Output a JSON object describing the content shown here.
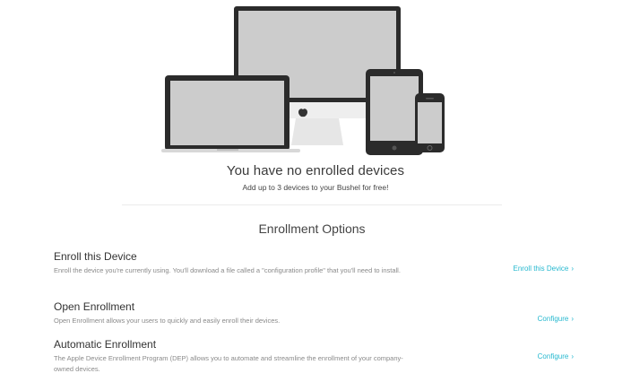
{
  "empty_state": {
    "title": "You have no enrolled devices",
    "subtitle": "Add up to 3 devices to your Bushel for free!",
    "illustration": "devices-illustration (monitor, laptop, tablet, phone)"
  },
  "section": {
    "title": "Enrollment Options"
  },
  "options": [
    {
      "title": "Enroll this Device",
      "description": "Enroll the device you're currently using. You'll download a file called a \"configuration profile\" that you'll need to install.",
      "action": "Enroll this Device"
    },
    {
      "title": "Open Enrollment",
      "description": "Open Enrollment allows your users to quickly and easily enroll their devices.",
      "action": "Configure"
    },
    {
      "title": "Automatic Enrollment",
      "description": "The Apple Device Enrollment Program (DEP) allows you to automate and streamline the enrollment of your company-owned devices.",
      "action": "Configure"
    }
  ],
  "colors": {
    "accent": "#26b8cf",
    "device_frame": "#2b2b2b",
    "device_screen": "#cccccc"
  },
  "icons": {
    "chevron": "chevron-right-icon",
    "apple_logo": "apple-logo-icon"
  }
}
